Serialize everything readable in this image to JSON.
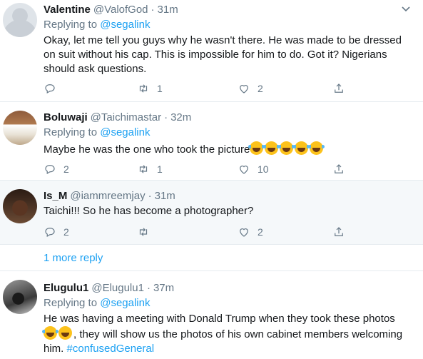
{
  "tweets": [
    {
      "name": "Valentine",
      "handle": "@ValofGod",
      "time": "31m",
      "replying_prefix": "Replying to",
      "replying_to": "@segalink",
      "text": "Okay, let me tell you guys why he wasn't there. He was made to be dressed on suit without his cap. This is impossible for him to do. Got it? Nigerians should ask questions.",
      "reply_count": "",
      "retweet_count": "1",
      "like_count": "2"
    },
    {
      "name": "Boluwaji",
      "handle": "@Taichimastar",
      "time": "32m",
      "replying_prefix": "Replying to",
      "replying_to": "@segalink",
      "text": "Maybe he was the one who took the picture",
      "reply_count": "2",
      "retweet_count": "1",
      "like_count": "10"
    },
    {
      "name": "Is_M",
      "handle": "@iammreemjay",
      "time": "31m",
      "text": "Taichi!!! So he has become a photographer?",
      "reply_count": "2",
      "retweet_count": "",
      "like_count": "2"
    },
    {
      "name": "Elugulu1",
      "handle": "@Elugulu1",
      "time": "37m",
      "replying_prefix": "Replying to",
      "replying_to": "@segalink",
      "text_line1": "He was having a meeting with Donald Trump when they took these photos",
      "text_line2": ", they will show us the photos of his own cabinet members welcoming",
      "text_line3": "him.",
      "hashtag": "#confusedGeneral"
    }
  ],
  "more_replies": "1 more reply",
  "colors": {
    "accent": "#1da1f2",
    "secondary_text": "#657786",
    "divider": "#e6ecf0",
    "shaded_bg": "#f5f8fa"
  }
}
